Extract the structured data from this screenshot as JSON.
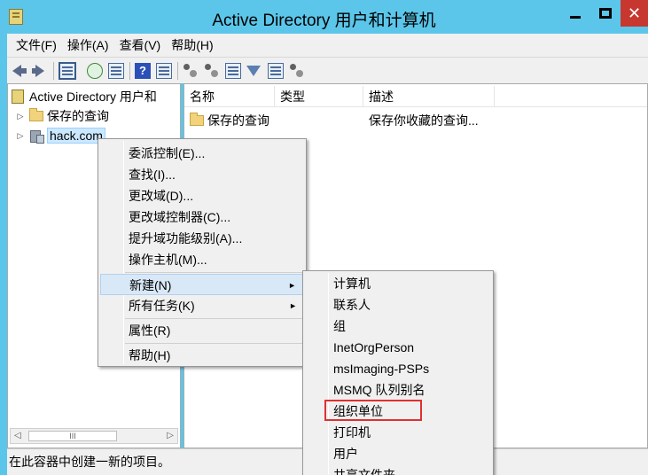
{
  "window": {
    "title": "Active Directory 用户和计算机",
    "controls": {
      "minimize": "minimize",
      "maximize": "maximize",
      "close": "✕"
    }
  },
  "menubar": {
    "items": [
      "文件(F)",
      "操作(A)",
      "查看(V)",
      "帮助(H)"
    ]
  },
  "toolbar": {
    "icons": [
      "back-arrow",
      "forward-arrow",
      "show-tree",
      "refresh",
      "export-list",
      "help",
      "properties-view",
      "find-users",
      "find-objects",
      "new-ou",
      "filter",
      "add-to-group",
      "delegate-control"
    ]
  },
  "tree": {
    "root": "Active Directory 用户和",
    "items": [
      {
        "label": "保存的查询",
        "icon": "folder-icon"
      },
      {
        "label": "hack.com",
        "icon": "domain-icon",
        "selected": true
      }
    ],
    "scrollbar_thumb": "III"
  },
  "list": {
    "columns": [
      "名称",
      "类型",
      "描述"
    ],
    "rows": [
      {
        "name": "保存的查询",
        "type": "",
        "description": "保存你收藏的查询..."
      }
    ]
  },
  "context_menu": {
    "items": [
      "委派控制(E)...",
      "查找(I)...",
      "更改域(D)...",
      "更改域控制器(C)...",
      "提升域功能级别(A)...",
      "操作主机(M)...",
      "新建(N)",
      "所有任务(K)",
      "属性(R)",
      "帮助(H)"
    ],
    "submenu_arrow": "►"
  },
  "submenu": {
    "items": [
      "计算机",
      "联系人",
      "组",
      "InetOrgPerson",
      "msImaging-PSPs",
      "MSMQ 队列别名",
      "组织单位",
      "打印机",
      "用户",
      "共享文件夹"
    ],
    "highlighted_item": "组织单位",
    "highlight_color": "#e03030"
  },
  "status": {
    "text": "在此容器中创建一新的项目。"
  }
}
